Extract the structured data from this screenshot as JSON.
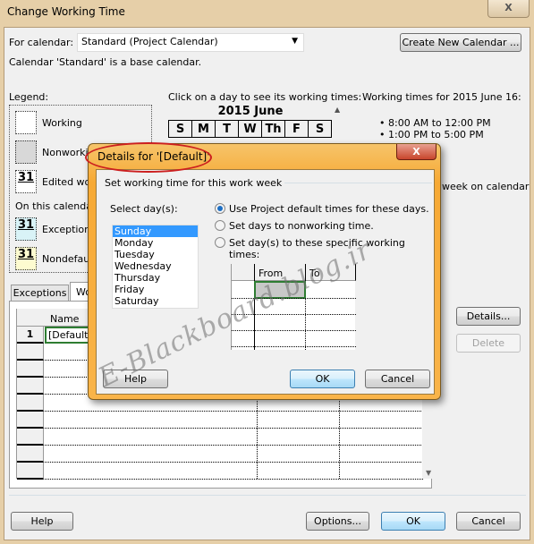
{
  "window": {
    "title": "Change Working Time",
    "close": "X"
  },
  "for_calendar": {
    "label": "For calendar:",
    "value": "Standard (Project Calendar)",
    "create_new": "Create New Calendar ...",
    "note": "Calendar 'Standard' is a base calendar."
  },
  "legend": {
    "label": "Legend:",
    "items": [
      "Working",
      "Nonworking",
      "Edited wo",
      "Exception",
      "Nondefau"
    ],
    "on_this_calendar": "On this calendar:",
    "day_num": "31"
  },
  "calendar": {
    "instruction": "Click on a day to see its working times:",
    "month": "2015 June",
    "days": [
      "S",
      "M",
      "T",
      "W",
      "Th",
      "F",
      "S"
    ]
  },
  "working_times": {
    "title": "Working times for 2015 June 16:",
    "times": [
      "8:00 AM to 12:00 PM",
      "1:00 PM to 5:00 PM"
    ],
    "partial_text": "week on calendar"
  },
  "tabs": [
    "Exceptions",
    "Wo"
  ],
  "table": {
    "header": "Name",
    "rows": [
      {
        "num": "1",
        "name": "[Default]"
      }
    ]
  },
  "side_buttons": {
    "details": "Details...",
    "delete": "Delete"
  },
  "footer": {
    "help": "Help",
    "options": "Options...",
    "ok": "OK",
    "cancel": "Cancel"
  },
  "modal": {
    "title": "Details for '[Default]'",
    "close": "X",
    "group": "Set working time for this work week",
    "select_label": "Select day(s):",
    "days": [
      "Sunday",
      "Monday",
      "Tuesday",
      "Wednesday",
      "Thursday",
      "Friday",
      "Saturday"
    ],
    "selected_day": "Sunday",
    "options": [
      "Use Project default times for these days.",
      "Set days to nonworking time.",
      "Set day(s) to these specific working times:"
    ],
    "selected_option": 0,
    "grid_headers": [
      "From",
      "To"
    ],
    "help": "Help",
    "ok": "OK",
    "cancel": "Cancel"
  },
  "watermark": "E-Blackboard.blog.ir",
  "colors": {
    "accent": "#3399ff",
    "modal_frame": "#f7a934",
    "highlight_circle": "#cc1f1f"
  }
}
